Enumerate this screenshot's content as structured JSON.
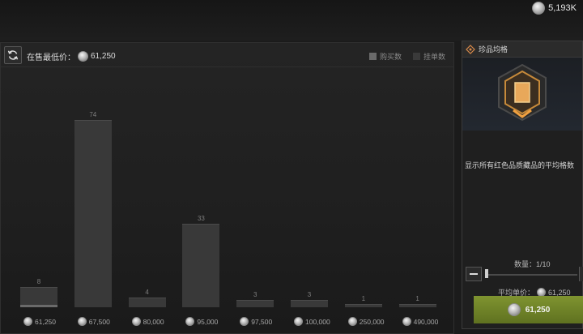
{
  "header": {
    "faint_title": "",
    "currency_value": "5,193K",
    "currency_icon": "coin-icon"
  },
  "chart_panel": {
    "min_price_label": "在售最低价：",
    "min_price_value": "61,250",
    "legend": [
      {
        "label": "购买数",
        "color": "#6a6a6a"
      },
      {
        "label": "挂单数",
        "color": "#3a3a3a"
      }
    ]
  },
  "chart_data": {
    "type": "bar",
    "categories": [
      "61,250",
      "67,500",
      "80,000",
      "95,000",
      "97,500",
      "100,000",
      "250,000",
      "490,000"
    ],
    "series": [
      {
        "values": [
          8,
          74,
          4,
          33,
          3,
          3,
          1,
          1
        ]
      }
    ],
    "bar_label_values": [
      "8",
      "74",
      "4",
      "33",
      "3",
      "3",
      "1",
      "1"
    ],
    "buy_highlight": [
      1,
      0,
      0,
      0,
      0,
      0,
      0,
      0
    ],
    "ylim": [
      0,
      80
    ]
  },
  "detail_panel": {
    "title": "珍品均格",
    "description": "显示所有红色品质藏品的平均格数",
    "quantity_label": "数量：1/10",
    "avg_price_label": "平均单价：",
    "avg_price_value": "61,250",
    "buy_button_value": "61,250",
    "quantity_fraction": 0.1
  }
}
